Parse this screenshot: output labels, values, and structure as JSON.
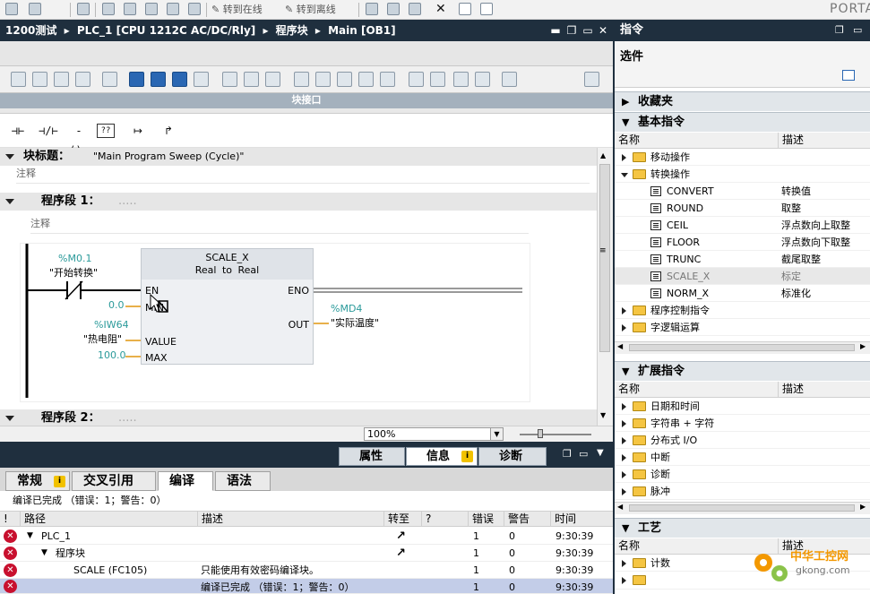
{
  "toolbar": {
    "go_online": "转到在线",
    "go_offline": "转到离线",
    "brand": "PORTA"
  },
  "editor": {
    "breadcrumb": [
      "1200测试",
      "PLC_1 [CPU 1212C AC/DC/Rly]",
      "程序块",
      "Main [OB1]"
    ],
    "interface_label": "块接口",
    "block_title_label": "块标题：",
    "block_title_value": "\"Main Program Sweep (Cycle)\"",
    "comment_label": "注释",
    "network1_label": "程序段 1：",
    "network1_dots": ".....",
    "network1_comment": "注释",
    "network2_label": "程序段 2：",
    "network2_dots": ".....",
    "zoom": "100%",
    "lad_palette": [
      "⊣⊢",
      "⊣/⊢",
      "-()-",
      "??",
      "↦",
      "↱"
    ]
  },
  "ladder": {
    "contact_addr": "%M0.1",
    "contact_name": "\"开始转换\"",
    "box_name": "SCALE_X",
    "box_types": [
      "Real",
      "to",
      "Real"
    ],
    "pin_en": "EN",
    "pin_eno": "ENO",
    "pin_min": "MIN",
    "pin_value": "VALUE",
    "pin_max": "MAX",
    "pin_out": "OUT",
    "min_value": "0.0",
    "value_addr": "%IW64",
    "value_name": "\"热电阻\"",
    "max_value": "100.0",
    "out_addr": "%MD4",
    "out_name": "\"实际温度\""
  },
  "inspector": {
    "tabs": [
      "属性",
      "信息",
      "诊断"
    ],
    "subtabs": [
      "常规",
      "交叉引用",
      "编译",
      "语法"
    ],
    "status": "编译已完成 （错误：1；警告：0）",
    "columns": [
      "!",
      "路径",
      "描述",
      "转至",
      "?",
      "错误",
      "警告",
      "时间"
    ],
    "rows": [
      {
        "path": "PLC_1",
        "desc": "",
        "goto": true,
        "errors": "1",
        "warnings": "0",
        "time": "9:30:39"
      },
      {
        "path": "程序块",
        "desc": "",
        "goto": true,
        "errors": "1",
        "warnings": "0",
        "time": "9:30:39"
      },
      {
        "path": "SCALE (FC105)",
        "desc": "只能使用有效密码编译块。",
        "goto": false,
        "errors": "1",
        "warnings": "0",
        "time": "9:30:39"
      },
      {
        "path": "",
        "desc": "编译已完成 （错误：1；警告：0）",
        "goto": false,
        "errors": "1",
        "warnings": "0",
        "time": "9:30:39"
      }
    ]
  },
  "right_panel": {
    "title": "指令",
    "options": "选件",
    "favorites": "收藏夹",
    "basic": "基本指令",
    "col_name": "名称",
    "col_desc": "描述",
    "basic_rows": [
      {
        "name": "移动操作",
        "desc": ""
      },
      {
        "name": "转换操作",
        "desc": ""
      },
      {
        "name": "CONVERT",
        "desc": "转换值"
      },
      {
        "name": "ROUND",
        "desc": "取整"
      },
      {
        "name": "CEIL",
        "desc": "浮点数向上取整"
      },
      {
        "name": "FLOOR",
        "desc": "浮点数向下取整"
      },
      {
        "name": "TRUNC",
        "desc": "截尾取整"
      },
      {
        "name": "SCALE_X",
        "desc": "标定"
      },
      {
        "name": "NORM_X",
        "desc": "标准化"
      },
      {
        "name": "程序控制指令",
        "desc": ""
      },
      {
        "name": "字逻辑运算",
        "desc": ""
      }
    ],
    "extended": "扩展指令",
    "ext_rows": [
      {
        "name": "日期和时间",
        "desc": ""
      },
      {
        "name": "字符串 + 字符",
        "desc": ""
      },
      {
        "name": "分布式 I/O",
        "desc": ""
      },
      {
        "name": "中断",
        "desc": ""
      },
      {
        "name": "诊断",
        "desc": ""
      },
      {
        "name": "脉冲",
        "desc": ""
      }
    ],
    "tech": "工艺",
    "tech_rows": [
      {
        "name": "计数",
        "desc": ""
      }
    ]
  },
  "watermark": {
    "text": "中华工控网",
    "url": "gkong.com"
  },
  "colors": {
    "title_bar": "#1f2f3e",
    "address": "#2a9a9a",
    "error": "#c8102e",
    "wire": "#000000"
  }
}
